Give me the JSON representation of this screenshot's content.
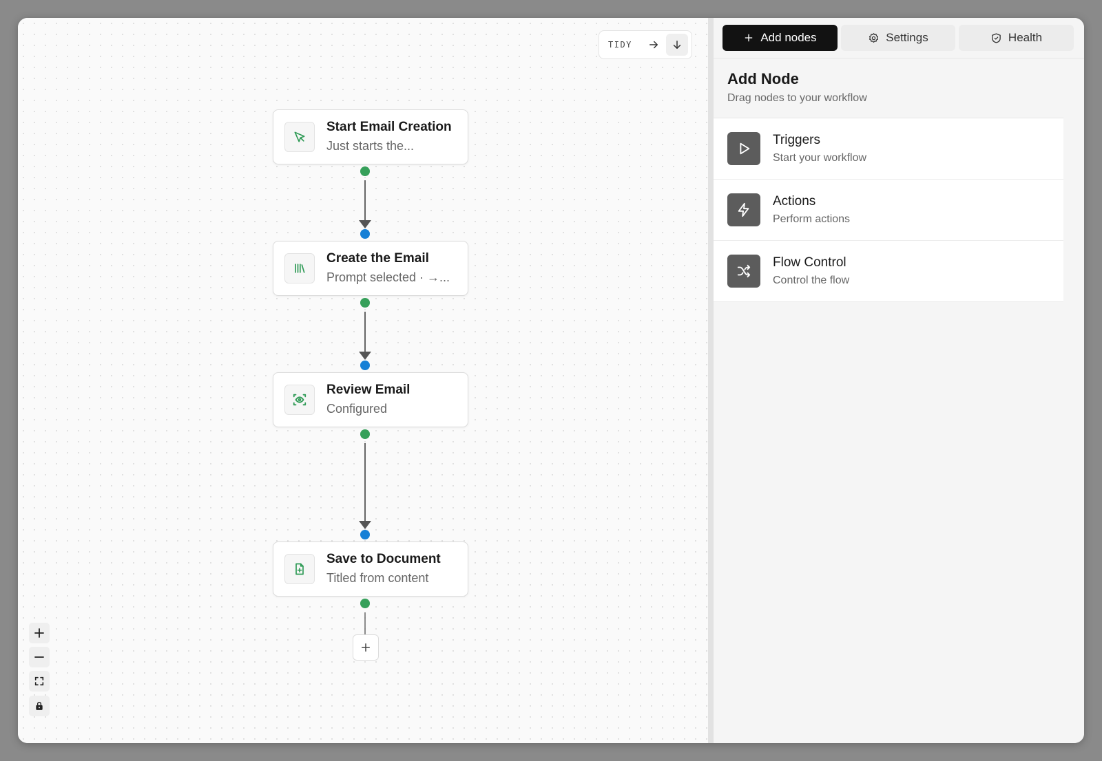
{
  "toolbar": {
    "tidy_label": "TIDY",
    "layout_horizontal_icon": "arrow-right-icon",
    "layout_vertical_icon": "arrow-down-icon"
  },
  "workflow": {
    "nodes": [
      {
        "title": "Start Email Creation",
        "subtitle": "Just starts the...",
        "icon": "cursor-pointer-icon"
      },
      {
        "title": "Create the Email",
        "subtitle": "Prompt selected · →...",
        "icon": "library-icon"
      },
      {
        "title": "Review Email",
        "subtitle": "Configured",
        "icon": "eye-scan-icon"
      },
      {
        "title": "Save to Document",
        "subtitle": "Titled from content",
        "icon": "file-plus-icon"
      }
    ],
    "add_step_icon": "plus-icon"
  },
  "zoom_controls": [
    "zoom-in-icon",
    "zoom-out-icon",
    "fit-view-icon",
    "lock-icon"
  ],
  "panel": {
    "tabs": [
      {
        "label": "Add nodes",
        "icon": "plus-icon",
        "active": true
      },
      {
        "label": "Settings",
        "icon": "gear-icon",
        "active": false
      },
      {
        "label": "Health",
        "icon": "shield-check-icon",
        "active": false
      }
    ],
    "title": "Add Node",
    "subtitle": "Drag nodes to your workflow",
    "categories": [
      {
        "title": "Triggers",
        "subtitle": "Start your workflow",
        "icon": "play-icon"
      },
      {
        "title": "Actions",
        "subtitle": "Perform actions",
        "icon": "lightning-icon"
      },
      {
        "title": "Flow Control",
        "subtitle": "Control the flow",
        "icon": "shuffle-icon"
      }
    ]
  },
  "colors": {
    "output_handle": "#36a05a",
    "input_handle": "#1680d6",
    "node_icon_accent": "#2e9a55",
    "active_tab": "#121212"
  }
}
